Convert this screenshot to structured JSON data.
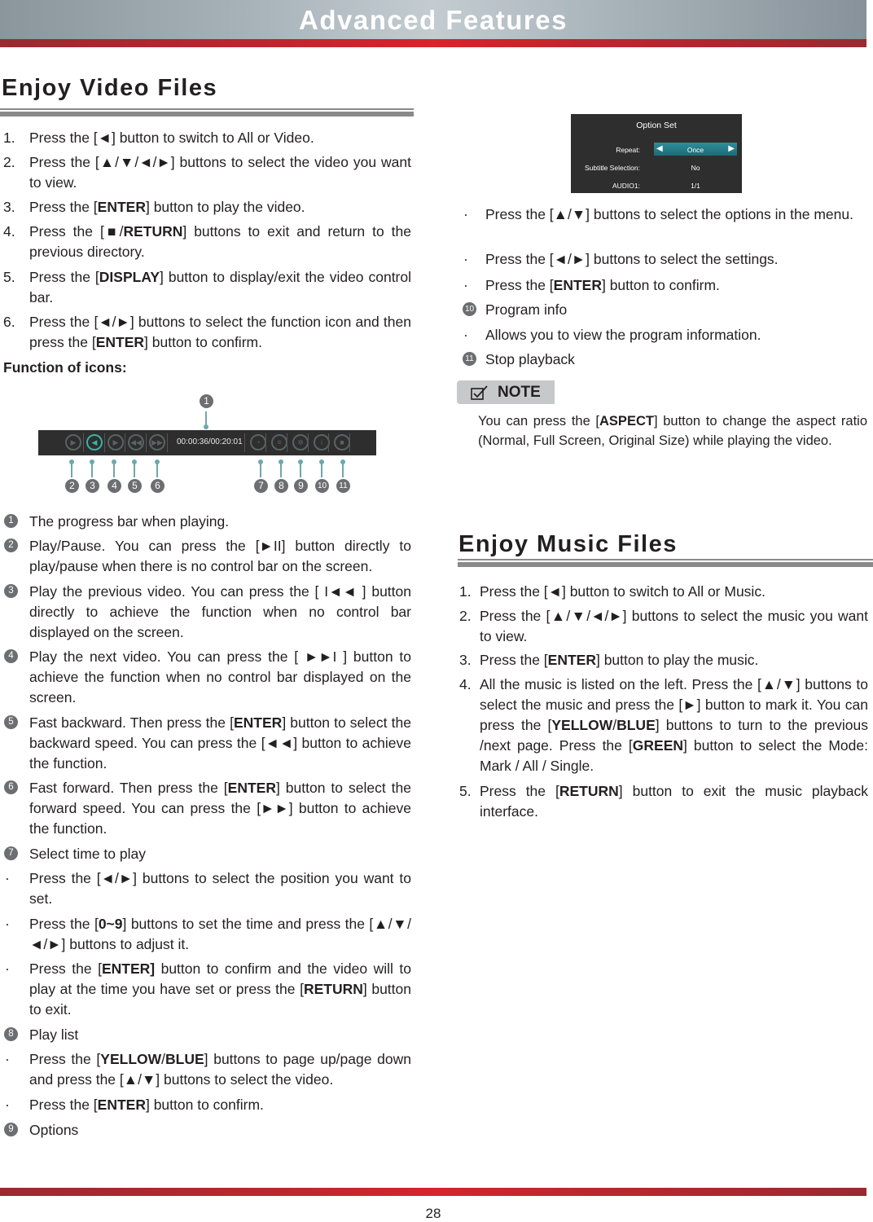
{
  "header": {
    "title": "Advanced Features"
  },
  "video": {
    "title": "Enjoy Video Files",
    "steps": [
      {
        "n": "1.",
        "html": "Press the [◄] button to switch to All or Video."
      },
      {
        "n": "2.",
        "html": "Press the [▲/▼/◄/►] buttons to select the video you want to view."
      },
      {
        "n": "3.",
        "html": "Press the [<b>ENTER</b>] button to play the video."
      },
      {
        "n": "4.",
        "html": "Press the [■/<b>RETURN</b>] buttons to exit and return to the previous directory."
      },
      {
        "n": "5.",
        "html": "Press the [<b>DISPLAY</b>] button to display/exit the video control bar."
      },
      {
        "n": "6.",
        "html": "Press the [◄/►] buttons to select the function icon and then press the [<b>ENTER</b>] button to confirm."
      }
    ],
    "function_heading": "Function of icons:",
    "control_bar": {
      "time": "00:00:36/00:20:01",
      "icons": [
        "play-pause-icon",
        "previous-icon",
        "next-icon",
        "fast-backward-icon",
        "fast-forward-icon",
        "time-icon",
        "playlist-icon",
        "options-icon",
        "info-icon",
        "stop-icon"
      ],
      "callouts": [
        "1",
        "2",
        "3",
        "4",
        "5",
        "6",
        "7",
        "8",
        "9",
        "10",
        "11"
      ],
      "active_color": "#38b2a3"
    },
    "functions": [
      {
        "type": "badge",
        "n": "1",
        "html": "The progress bar when playing."
      },
      {
        "type": "badge",
        "n": "2",
        "html": "Play/Pause. You can press the [►II] button directly to play/pause when there is no control bar on the screen."
      },
      {
        "type": "badge",
        "n": "3",
        "html": "Play the previous video. You can press the [ I◄◄ ] button directly to achieve the function when no control bar displayed on the screen."
      },
      {
        "type": "badge",
        "n": "4",
        "html": "Play the next video. You can press the [ ►►I ] button to achieve the function when no control bar displayed on the screen."
      },
      {
        "type": "badge",
        "n": "5",
        "html": "Fast backward. Then press the [<b>ENTER</b>] button to select the backward speed. You can press the [◄◄] button to achieve the function."
      },
      {
        "type": "badge",
        "n": "6",
        "html": "Fast forward. Then press the [<b>ENTER</b>] button to select the forward speed. You can press the [►►] button to achieve the function."
      },
      {
        "type": "badge",
        "n": "7",
        "html": "Select time to play"
      },
      {
        "type": "dot",
        "n": "·",
        "html": "Press the [◄/►] buttons to select the position you want to set."
      },
      {
        "type": "dot",
        "n": "·",
        "html": "Press the [<b>0~9</b>] buttons to set the time and press the [▲/▼/◄/►] buttons to adjust it."
      },
      {
        "type": "dot",
        "n": "·",
        "html": "Press the [<b>ENTER]</b> button to confirm and the video will to play at the time you have set or press the [<b>RETURN</b>] button to exit."
      },
      {
        "type": "badge",
        "n": "8",
        "html": "Play list"
      },
      {
        "type": "dot",
        "n": "·",
        "html": "Press the [<b>YELLOW</b>/<b>BLUE</b>] buttons to page up/page down and press the [▲/▼] buttons to select the video."
      },
      {
        "type": "dot",
        "n": "·",
        "html": "Press the [<b>ENTER</b>] button to confirm."
      },
      {
        "type": "badge",
        "n": "9",
        "html": "Options"
      }
    ]
  },
  "option_set": {
    "title": "Option Set",
    "rows": [
      {
        "label": "Repeat:",
        "value": "Once",
        "selected": true
      },
      {
        "label": "Subtitle Selection:",
        "value": "No"
      },
      {
        "label": "AUDIO1:",
        "value": "1/1"
      }
    ]
  },
  "right_items": [
    {
      "type": "dot",
      "n": "·",
      "html": "Press the [▲/▼] buttons to select the options in the menu."
    },
    {
      "type": "dot",
      "n": "·",
      "html": "Press the [◄/►] buttons to select the settings."
    },
    {
      "type": "dot",
      "n": "·",
      "html": "Press the [<b>ENTER</b>] button to confirm."
    },
    {
      "type": "badge",
      "n": "10",
      "html": "Program info"
    },
    {
      "type": "dot",
      "n": "·",
      "html": "Allows you to view the program information."
    },
    {
      "type": "badge",
      "n": "11",
      "html": "Stop playback"
    }
  ],
  "note": {
    "label": "NOTE",
    "html": "You can press the [<b>ASPECT</b>] button to change the aspect ratio (Normal, Full Screen, Original Size) while playing the video."
  },
  "music": {
    "title": "Enjoy Music Files",
    "steps": [
      {
        "n": "1.",
        "html": "Press the [◄] button to switch to All or Music."
      },
      {
        "n": "2.",
        "html": "Press the [▲/▼/◄/►] buttons to select the music you want to view."
      },
      {
        "n": "3.",
        "html": "Press the [<b>ENTER</b>] button to play the music."
      },
      {
        "n": "4.",
        "html": "All the music is listed on the left. Press the [▲/▼] buttons to select the music and press the [►] button to mark it. You can press the [<b>YELLOW</b>/<b>BLUE</b>] buttons to turn to the previous /next page. Press the [<b>GREEN</b>] button to select the Mode: Mark / All / Single."
      },
      {
        "n": "5.",
        "html": "Press the [<b>RETURN</b>] button to exit the music playback interface."
      }
    ]
  },
  "page_number": "28"
}
